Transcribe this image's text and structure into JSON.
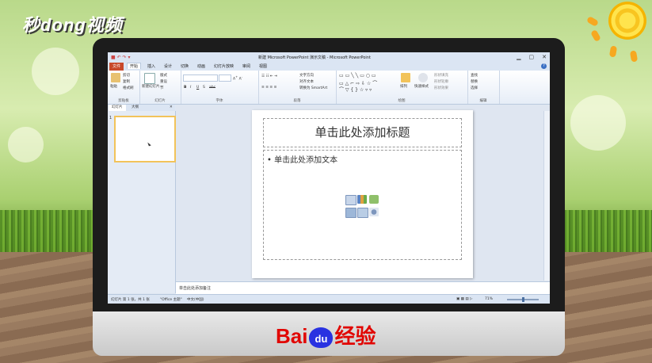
{
  "watermark": {
    "brand": "秒dong视频"
  },
  "bottom_logo": {
    "bai": "Bai",
    "du": "du",
    "jingyan": "经验"
  },
  "window": {
    "title": "新建 Microsoft PowerPoint 演示文稿 - Microsoft PowerPoint",
    "minimize_glyph": "▁",
    "maximize_glyph": "▢",
    "close_glyph": "✕",
    "help_glyph": "?"
  },
  "tabs": {
    "file": "文件",
    "items": [
      "开始",
      "插入",
      "设计",
      "切换",
      "动画",
      "幻灯片放映",
      "审阅",
      "视图"
    ]
  },
  "ribbon": {
    "clipboard": {
      "paste": "粘贴",
      "cut": "剪切",
      "copy": "复制",
      "format_painter": "格式刷",
      "label": "剪贴板"
    },
    "slides": {
      "new_slide": "新建幻灯片",
      "layout": "版式",
      "reset": "重设",
      "section": "节",
      "label": "幻灯片"
    },
    "font": {
      "label": "字体",
      "bold": "B",
      "italic": "I",
      "underline": "U",
      "strike": "S",
      "shadow": "abc"
    },
    "paragraph": {
      "label": "段落",
      "text_direction": "文字方向",
      "align_text": "对齐文本",
      "smartart": "转换为 SmartArt"
    },
    "drawing": {
      "label": "绘图",
      "arrange": "排列",
      "quick_styles": "快速样式",
      "shape_fill": "形状填充",
      "shape_outline": "形状轮廓",
      "shape_effects": "形状效果"
    },
    "editing": {
      "label": "编辑",
      "find": "查找",
      "replace": "替换",
      "select": "选择"
    }
  },
  "pane": {
    "tab_slides": "幻灯片",
    "tab_outline": "大纲",
    "slide_number": "1"
  },
  "slide": {
    "title_placeholder": "单击此处添加标题",
    "body_placeholder": "• 单击此处添加文本"
  },
  "notes": {
    "placeholder": "单击此处添加备注"
  },
  "status": {
    "slide_info": "幻灯片 第 1 张，共 1 张",
    "theme": "\"Office 主题\"",
    "language": "中文(中国)",
    "zoom": "71%"
  },
  "colors": {
    "file_tab": "#c8492b",
    "thumb_border": "#f2c35a",
    "baidu_red": "#e10602",
    "baidu_blue": "#2932e1"
  }
}
